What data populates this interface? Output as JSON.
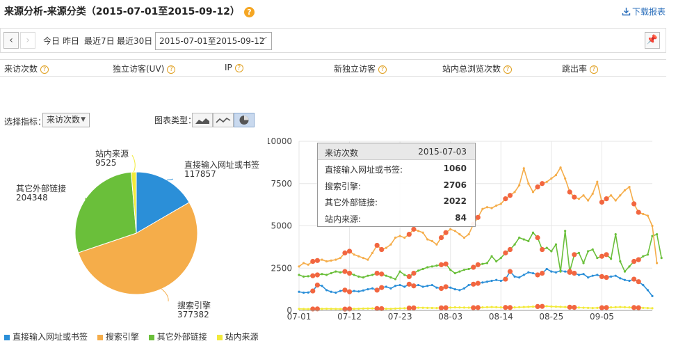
{
  "header": {
    "title": "来源分析-来源分类（2015-07-01至2015-09-12）",
    "help_icon": "question-circle-icon",
    "download_label": "下载报表",
    "download_icon": "download-icon"
  },
  "toolbar": {
    "prev_icon": "chevron-left-icon",
    "next_icon": "chevron-right-icon",
    "quick_ranges": [
      "今日",
      "昨日",
      "最近7日",
      "最近30日"
    ],
    "date_range": "2015-07-01至2015-09-12",
    "pin_icon": "pin-icon"
  },
  "metrics": [
    "来访次数",
    "独立访客(UV)",
    "IP",
    "新独立访客",
    "站内总浏览次数",
    "跳出率"
  ],
  "controls": {
    "selector_label": "选择指标：",
    "selector_value": "来访次数",
    "chart_type_label": "图表类型：",
    "chart_types": [
      "area-chart-icon",
      "line-chart-icon",
      "pie-chart-icon"
    ],
    "active_chart_type": 2
  },
  "colors": {
    "direct": "#2b8fd8",
    "search": "#f5ad4a",
    "external": "#6abf3a",
    "internal": "#f2ea3a",
    "marker": "#f26640"
  },
  "chart_data": [
    {
      "type": "pie",
      "labels": [
        "直接输入网址或书签",
        "搜索引擎",
        "其它外部链接",
        "站内来源"
      ],
      "values": [
        117857,
        377382,
        204348,
        9525
      ],
      "value_labels": [
        "117857",
        "377382",
        "204348",
        "9525"
      ]
    },
    {
      "type": "line",
      "x_tick_labels": [
        "07-01",
        "07-12",
        "07-23",
        "08-03",
        "08-14",
        "08-25",
        "09-05"
      ],
      "y_tick_labels": [
        "0",
        "2500",
        "5000",
        "7500",
        "10000"
      ],
      "ylim": [
        0,
        10000
      ],
      "start_date": "2015-07-01",
      "series": [
        {
          "name": "直接输入网址或书签",
          "values": [
            1100,
            1050,
            1060,
            1150,
            1500,
            1450,
            1200,
            1100,
            1050,
            1150,
            1200,
            1100,
            1150,
            1120,
            1180,
            1250,
            1300,
            1200,
            1350,
            1400,
            1300,
            1450,
            1500,
            1400,
            1550,
            1450,
            1500,
            1400,
            1450,
            1500,
            1350,
            1300,
            1400,
            1350,
            1250,
            1200,
            1300,
            1500,
            1550,
            1600,
            1650,
            1700,
            1750,
            1800,
            1750,
            1850,
            2300,
            2000,
            1950,
            2100,
            2250,
            2200,
            2100,
            2200,
            2450,
            2300,
            2250,
            2350,
            2300,
            2250,
            2200,
            2100,
            2150,
            1950,
            2050,
            2100,
            2000,
            1950,
            2000,
            2050,
            1900,
            1800,
            1750,
            1850,
            1700,
            1500,
            1200,
            850
          ]
        },
        {
          "name": "搜索引擎",
          "values": [
            2600,
            2800,
            2706,
            2900,
            2950,
            3000,
            2900,
            2950,
            3000,
            3100,
            3400,
            3500,
            3300,
            3200,
            3100,
            3000,
            3400,
            3850,
            3600,
            3700,
            3900,
            4300,
            4400,
            4300,
            4500,
            4800,
            4700,
            4600,
            4200,
            4100,
            3900,
            4300,
            4600,
            4800,
            4700,
            4500,
            4300,
            4500,
            5100,
            5500,
            6000,
            6100,
            6050,
            6200,
            6300,
            6600,
            6800,
            7000,
            7400,
            8400,
            7500,
            7000,
            7300,
            7500,
            7600,
            7800,
            8000,
            8450,
            7800,
            7000,
            6700,
            6600,
            6800,
            6500,
            6900,
            7600,
            6400,
            6600,
            6800,
            6500,
            6800,
            7100,
            7300,
            6300,
            5800,
            5700,
            5600,
            5000,
            2800
          ]
        },
        {
          "name": "其它外部链接",
          "values": [
            2100,
            2000,
            2022,
            2050,
            2100,
            2150,
            2100,
            2200,
            2300,
            2250,
            2300,
            2200,
            2100,
            2000,
            1950,
            2050,
            2100,
            2200,
            2150,
            2050,
            1950,
            1850,
            2300,
            2100,
            2000,
            2200,
            2350,
            2450,
            2550,
            2600,
            2650,
            2700,
            2750,
            2400,
            2200,
            2300,
            2400,
            2450,
            2550,
            2700,
            2750,
            2800,
            3200,
            2900,
            3100,
            3400,
            3600,
            3900,
            4300,
            4200,
            4100,
            4600,
            4300,
            3600,
            3700,
            3500,
            3900,
            2300,
            4700,
            2300,
            3300,
            3400,
            2800,
            3500,
            3600,
            3100,
            3200,
            3300,
            3050,
            4500,
            2900,
            2300,
            2600,
            2900,
            3000,
            3200,
            3300,
            4400,
            4500,
            3100
          ]
        },
        {
          "name": "站内来源",
          "values": [
            90,
            84,
            80,
            85,
            90,
            95,
            100,
            95,
            90,
            85,
            80,
            90,
            95,
            100,
            110,
            115,
            120,
            110,
            105,
            100,
            95,
            110,
            120,
            130,
            140,
            150,
            160,
            155,
            150,
            145,
            140,
            150,
            160,
            170,
            180,
            175,
            170,
            165,
            160,
            170,
            180,
            190,
            200,
            190,
            180,
            175,
            170,
            180,
            190,
            200,
            210,
            220,
            230,
            240,
            250,
            230,
            220,
            210,
            200,
            190,
            180,
            170,
            160,
            150,
            140,
            150,
            160,
            170,
            180,
            190,
            200,
            190,
            180,
            170,
            160,
            150,
            140,
            130
          ]
        }
      ],
      "tooltip": {
        "metric": "来访次数",
        "date": "2015-07-03",
        "rows": [
          {
            "label": "直接输入网址或书签:",
            "value": "1060"
          },
          {
            "label": "搜索引擎:",
            "value": "2706"
          },
          {
            "label": "其它外部链接:",
            "value": "2022"
          },
          {
            "label": "站内来源:",
            "value": "84"
          }
        ]
      }
    }
  ],
  "legend": [
    "直接输入网址或书签",
    "搜索引擎",
    "其它外部链接",
    "站内来源"
  ]
}
